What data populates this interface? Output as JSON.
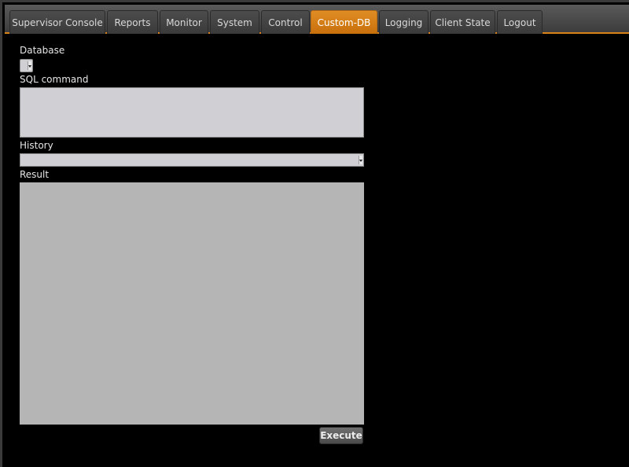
{
  "nav": {
    "tabs": [
      {
        "label": "Supervisor Console",
        "active": false
      },
      {
        "label": "Reports",
        "active": false
      },
      {
        "label": "Monitor",
        "active": false
      },
      {
        "label": "System",
        "active": false
      },
      {
        "label": "Control",
        "active": false
      },
      {
        "label": "Custom-DB",
        "active": true
      },
      {
        "label": "Logging",
        "active": false
      },
      {
        "label": "Client State",
        "active": false
      },
      {
        "label": "Logout",
        "active": false
      }
    ]
  },
  "form": {
    "database_label": "Database",
    "database_value": "",
    "sql_label": "SQL command",
    "sql_value": "",
    "history_label": "History",
    "history_value": "",
    "result_label": "Result",
    "result_value": "",
    "execute_label": "Execute"
  },
  "colors": {
    "accent": "#d9821a",
    "background": "#000000",
    "input_bg": "#d0cfd4",
    "result_bg": "#b5b5b5"
  }
}
